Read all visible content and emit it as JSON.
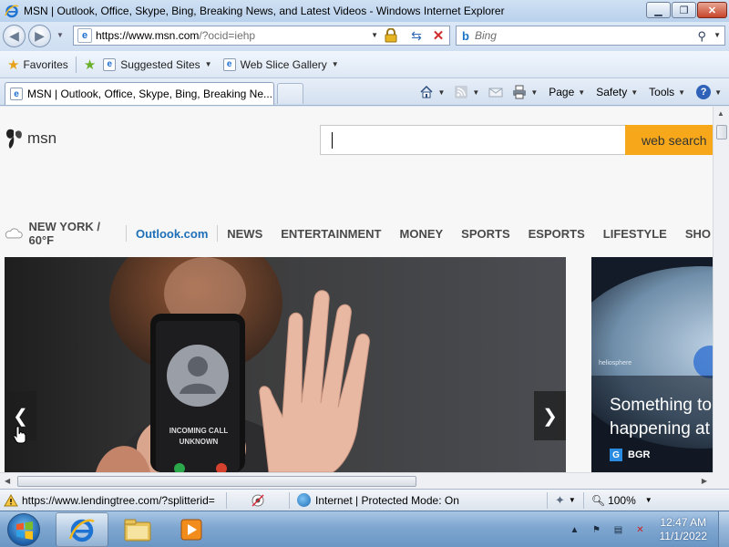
{
  "window": {
    "title": "MSN | Outlook, Office, Skype, Bing, Breaking News, and Latest Videos - Windows Internet Explorer"
  },
  "address": {
    "url_main": "https://www.msn.com",
    "url_rest": "/?ocid=iehp"
  },
  "search": {
    "placeholder": "Bing"
  },
  "favorites": {
    "label": "Favorites",
    "items": [
      {
        "label": "Suggested Sites"
      },
      {
        "label": "Web Slice Gallery"
      }
    ]
  },
  "tabs": [
    {
      "label": "MSN | Outlook, Office, Skype, Bing, Breaking Ne..."
    }
  ],
  "commandbar": {
    "page": "Page",
    "safety": "Safety",
    "tools": "Tools"
  },
  "msn": {
    "logo_text": "msn",
    "search_button": "web search",
    "weather": "NEW YORK / 60°F",
    "nav": [
      "Outlook.com",
      "NEWS",
      "ENTERTAINMENT",
      "MONEY",
      "SPORTS",
      "ESPORTS",
      "LIFESTYLE",
      "SHO"
    ],
    "hero": {
      "phone_line1": "INCOMING CALL",
      "phone_line2": "UNKNOWN"
    },
    "side_card": {
      "headline_line1": "Something to",
      "headline_line2": "happening at",
      "source": "BGR",
      "source_badge": "G",
      "image_label": "heliosphere"
    }
  },
  "status": {
    "url": "https://www.lendingtree.com/?splitterid=",
    "zone": "Internet | Protected Mode: On",
    "zoom": "100%"
  },
  "taskbar": {
    "time": "12:47 AM",
    "date": "11/1/2022"
  },
  "colors": {
    "accent": "#1d6fb8",
    "websearch": "#f6a81a"
  }
}
